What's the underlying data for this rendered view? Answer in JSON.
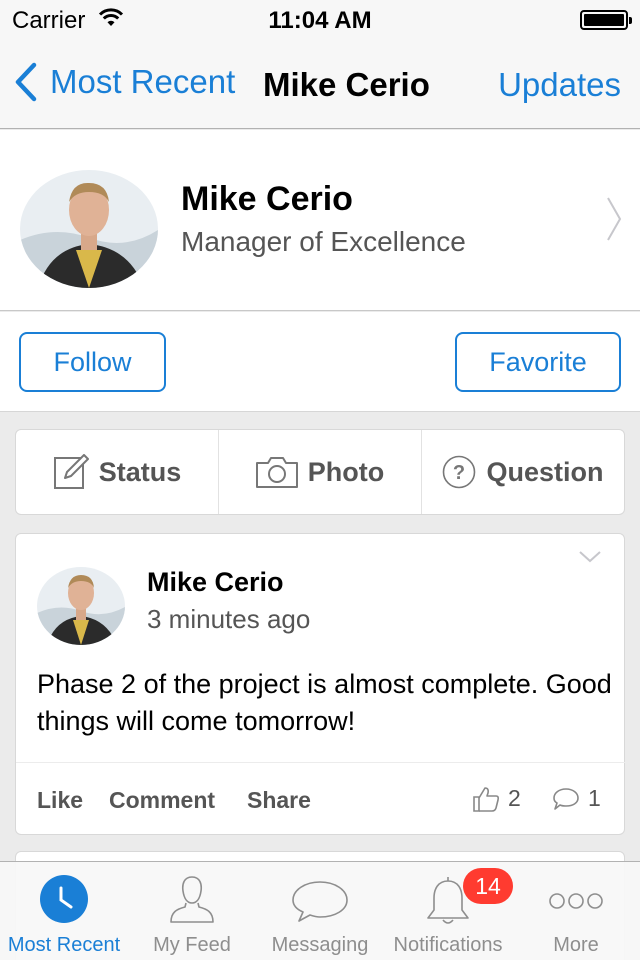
{
  "status_bar": {
    "carrier": "Carrier",
    "time": "11:04 AM"
  },
  "nav": {
    "back_label": "Most Recent",
    "title": "Mike Cerio",
    "right_label": "Updates"
  },
  "profile": {
    "name": "Mike Cerio",
    "title": "Manager of Excellence"
  },
  "actions": {
    "follow_label": "Follow",
    "favorite_label": "Favorite"
  },
  "compose": {
    "status_label": "Status",
    "photo_label": "Photo",
    "question_label": "Question"
  },
  "post": {
    "author": "Mike Cerio",
    "time": "3 minutes ago",
    "body": "Phase 2 of the project is almost complete. Good things will come tomorrow!",
    "like_label": "Like",
    "comment_label": "Comment",
    "share_label": "Share",
    "like_count": "2",
    "comment_count": "1"
  },
  "tabbar": {
    "tabs": [
      {
        "label": "Most Recent",
        "icon": "clock-icon",
        "active": true
      },
      {
        "label": "My Feed",
        "icon": "person-icon",
        "active": false
      },
      {
        "label": "Messaging",
        "icon": "chat-bubble-icon",
        "active": false
      },
      {
        "label": "Notifications",
        "icon": "bell-icon",
        "active": false,
        "badge": "14"
      },
      {
        "label": "More",
        "icon": "more-dots-icon",
        "active": false
      }
    ]
  },
  "colors": {
    "accent": "#1a7fd6",
    "badge": "#ff3b30",
    "background": "#ebebeb"
  }
}
